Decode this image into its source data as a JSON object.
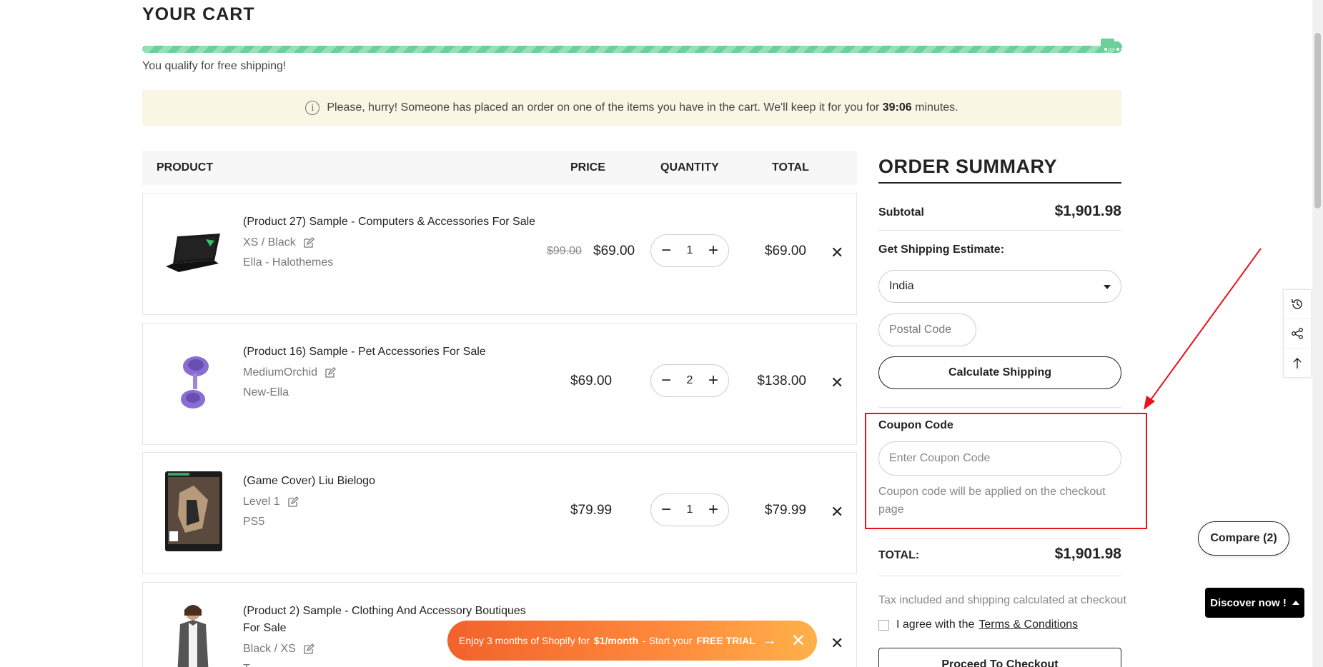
{
  "page": {
    "title": "YOUR CART"
  },
  "shipping": {
    "message": "You qualify for free shipping!",
    "progress": 1.0
  },
  "hurry": {
    "text_before": "Please, hurry! Someone has placed an order on one of the items you have in the cart. We'll keep it for you for",
    "timer": "39:06",
    "text_after": "minutes."
  },
  "table": {
    "headers": [
      "PRODUCT",
      "PRICE",
      "QUANTITY",
      "TOTAL"
    ]
  },
  "items": [
    {
      "name": "(Product 27) Sample - Computers & Accessories For Sale",
      "variant": "XS / Black",
      "vendor": "Ella - Halothemes",
      "old_price": "$99.00",
      "price": "$69.00",
      "qty": "1",
      "total": "$69.00",
      "thumb": "laptop"
    },
    {
      "name": "(Product 16) Sample - Pet Accessories For Sale",
      "variant": "MediumOrchid",
      "vendor": "New-Ella",
      "old_price": "",
      "price": "$69.00",
      "qty": "2",
      "total": "$138.00",
      "thumb": "pet-bowl"
    },
    {
      "name": "(Game Cover) Liu Bielogo",
      "variant": "Level 1",
      "vendor": "PS5",
      "old_price": "",
      "price": "$79.99",
      "qty": "1",
      "total": "$79.99",
      "thumb": "game-cover"
    },
    {
      "name": "(Product 2) Sample - Clothing And Accessory Boutiques For Sale",
      "variant": "Black / XS",
      "vendor": "T",
      "old_price": "",
      "price": "",
      "qty": "",
      "total": "",
      "thumb": "clothing-model"
    }
  ],
  "summary": {
    "title": "ORDER SUMMARY",
    "subtotal_label": "Subtotal",
    "subtotal_value": "$1,901.98",
    "shipping_label": "Get Shipping Estimate:",
    "country": "India",
    "postal_placeholder": "Postal Code",
    "calc_button": "Calculate Shipping",
    "coupon_label": "Coupon Code",
    "coupon_placeholder": "Enter Coupon Code",
    "coupon_note": "Coupon code will be applied on the checkout page",
    "total_label": "TOTAL:",
    "total_value": "$1,901.98",
    "tax_note": "Tax included and shipping calculated at checkout",
    "agree_text": "I agree with the",
    "agree_link": "Terms & Conditions",
    "checkout_button": "Proceed To Checkout"
  },
  "widgets": {
    "compare": "Compare (2)",
    "discover": "Discover now !",
    "tools": [
      "history-icon",
      "share-icon",
      "back-to-top-icon"
    ]
  },
  "promo": {
    "text1": "Enjoy 3 months of Shopify for",
    "price": "$1/month",
    "text2": "- Start your",
    "trial": "FREE TRIAL"
  },
  "colors": {
    "accent_green": "#6dcf9a",
    "annotation_red": "#e8141b",
    "promo_orange": "#f2622b"
  }
}
